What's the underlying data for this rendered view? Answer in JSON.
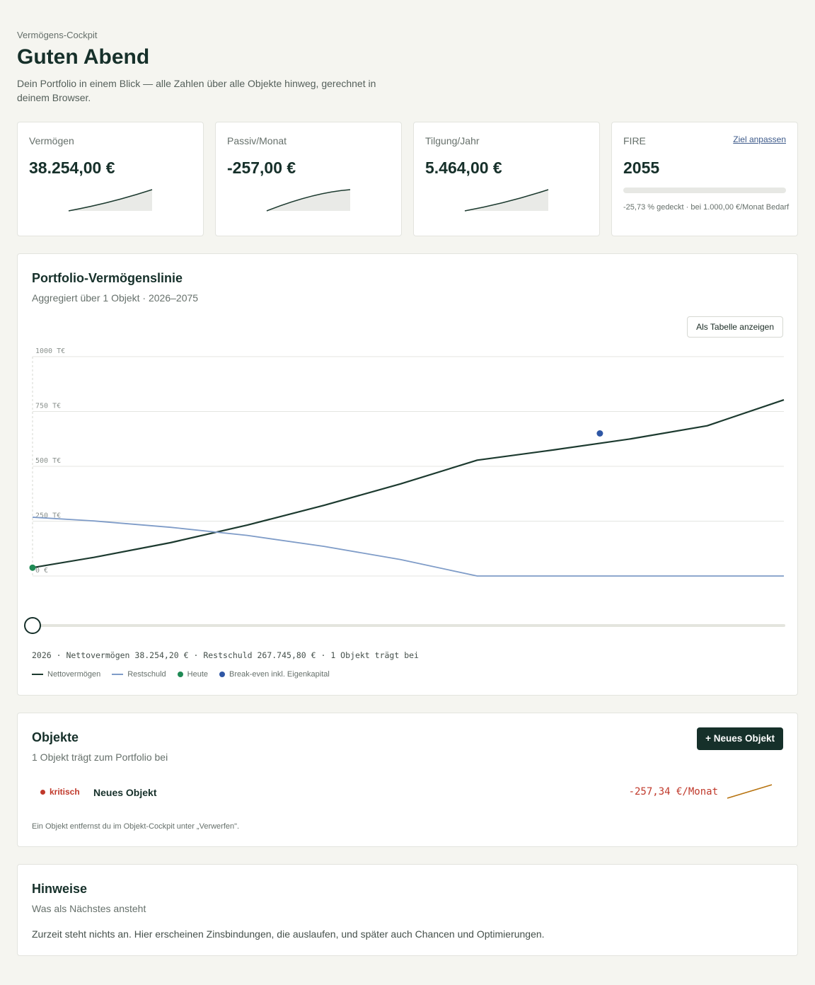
{
  "header": {
    "eyebrow": "Vermögens-Cockpit",
    "title": "Guten Abend",
    "lede": "Dein Portfolio in einem Blick — alle Zahlen über alle Objekte hinweg, gerechnet in deinem Browser."
  },
  "kpis": [
    {
      "label": "Vermögen",
      "value": "38.254,00 €"
    },
    {
      "label": "Passiv/Monat",
      "value": "-257,00 €"
    },
    {
      "label": "Tilgung/Jahr",
      "value": "5.464,00 €"
    }
  ],
  "fire": {
    "label": "FIRE",
    "link": "Ziel anpassen",
    "value": "2055",
    "progress": 0,
    "note": "-25,73 % gedeckt · bei 1.000,00 €/Monat Bedarf"
  },
  "portfolio": {
    "title": "Portfolio-Vermögenslinie",
    "subtitle": "Aggregiert über 1 Objekt · 2026–2075",
    "table_button": "Als Tabelle anzeigen",
    "summary": "2026 · Nettovermögen 38.254,20 € · Restschuld 267.745,80 € · 1 Objekt trägt bei",
    "legend": [
      {
        "label": "Nettovermögen",
        "color": "#1c3a2f",
        "kind": "line"
      },
      {
        "label": "Restschuld",
        "color": "#7f9cc8",
        "kind": "line"
      },
      {
        "label": "Heute",
        "color": "#1f8a55",
        "kind": "dot"
      },
      {
        "label": "Break-even inkl. Eigenkapital",
        "color": "#2f57a5",
        "kind": "dot"
      }
    ]
  },
  "chart_data": {
    "type": "line",
    "x": [
      2026,
      2030,
      2035,
      2040,
      2045,
      2050,
      2055,
      2060,
      2065,
      2070,
      2075
    ],
    "series": [
      {
        "name": "Nettovermögen",
        "values": [
          38,
          85,
          152,
          232,
          322,
          420,
          528,
          575,
          625,
          685,
          803
        ],
        "color": "#1c3a2f"
      },
      {
        "name": "Restschuld",
        "values": [
          268,
          251,
          222,
          185,
          135,
          75,
          0,
          0,
          0,
          0,
          0
        ],
        "color": "#7f9cc8"
      }
    ],
    "markers": [
      {
        "name": "Heute",
        "x": 2026,
        "y": 38,
        "color": "#1f8a55"
      },
      {
        "name": "Break-even inkl. Eigenkapital",
        "x": 2063,
        "y": 650,
        "color": "#2f57a5"
      }
    ],
    "yticks": [
      "1000 T€",
      "750 T€",
      "500 T€",
      "250 T€",
      "0 €"
    ],
    "ytick_values": [
      1000,
      750,
      500,
      250,
      0
    ],
    "xlim": [
      2026,
      2075
    ],
    "ylim": [
      0,
      1000
    ],
    "grid": true,
    "slider_year": 2026
  },
  "objects": {
    "title": "Objekte",
    "subtitle": "1 Objekt trägt zum Portfolio bei",
    "add_button": "+ Neues Objekt",
    "items": [
      {
        "status": "kritisch",
        "name": "Neues Objekt",
        "value": "-257,34 €/Monat"
      }
    ],
    "footnote": "Ein Objekt entfernst du im Objekt-Cockpit unter „Verwerfen\"."
  },
  "hints": {
    "title": "Hinweise",
    "subtitle": "Was als Nächstes ansteht",
    "empty": "Zurzeit steht nichts an. Hier erscheinen Zinsbindungen, die auslaufen, und später auch Chancen und Optimierungen."
  }
}
